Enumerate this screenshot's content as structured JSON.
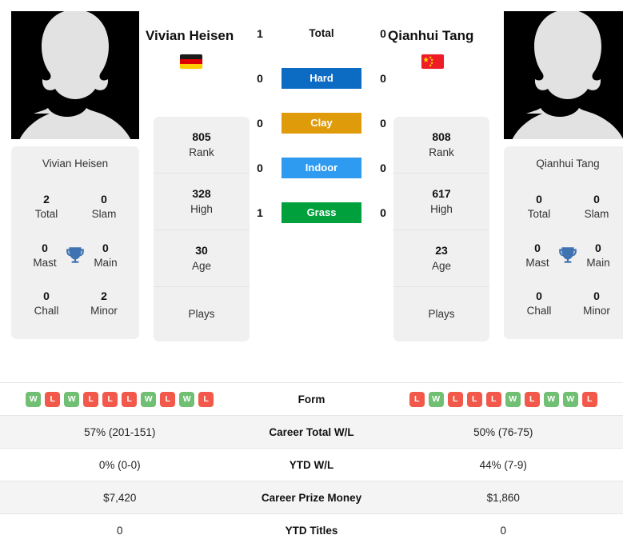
{
  "players": {
    "left": {
      "name": "Vivian Heisen",
      "flag": "germany-flag",
      "avatar": "player-silhouette",
      "rank": "805",
      "rank_label": "Rank",
      "high": "328",
      "high_label": "High",
      "age": "30",
      "age_label": "Age",
      "plays_label": "Plays",
      "plays_value": "",
      "titles": {
        "total": "2",
        "total_label": "Total",
        "slam": "0",
        "slam_label": "Slam",
        "mast": "0",
        "mast_label": "Mast",
        "main": "0",
        "main_label": "Main",
        "chall": "0",
        "chall_label": "Chall",
        "minor": "2",
        "minor_label": "Minor"
      },
      "scores": {
        "total": "1",
        "hard": "0",
        "clay": "0",
        "indoor": "0",
        "grass": "1"
      },
      "form": [
        "W",
        "L",
        "W",
        "L",
        "L",
        "L",
        "W",
        "L",
        "W",
        "L"
      ],
      "career_total_wl": "57% (201-151)",
      "ytd_wl": "0% (0-0)",
      "career_prize_money": "$7,420",
      "ytd_titles": "0"
    },
    "right": {
      "name": "Qianhui Tang",
      "flag": "china-flag",
      "avatar": "player-silhouette",
      "rank": "808",
      "rank_label": "Rank",
      "high": "617",
      "high_label": "High",
      "age": "23",
      "age_label": "Age",
      "plays_label": "Plays",
      "plays_value": "",
      "titles": {
        "total": "0",
        "total_label": "Total",
        "slam": "0",
        "slam_label": "Slam",
        "mast": "0",
        "mast_label": "Mast",
        "main": "0",
        "main_label": "Main",
        "chall": "0",
        "chall_label": "Chall",
        "minor": "0",
        "minor_label": "Minor"
      },
      "scores": {
        "total": "0",
        "hard": "0",
        "clay": "0",
        "indoor": "0",
        "grass": "0"
      },
      "form": [
        "L",
        "W",
        "L",
        "L",
        "L",
        "W",
        "L",
        "W",
        "W",
        "L"
      ],
      "career_total_wl": "50% (76-75)",
      "ytd_wl": "44% (7-9)",
      "career_prize_money": "$1,860",
      "ytd_titles": "0"
    }
  },
  "surfaces": [
    {
      "key": "total",
      "label": "Total",
      "color": "transparent",
      "text_color": "#111111"
    },
    {
      "key": "hard",
      "label": "Hard",
      "color": "#0c6cc4",
      "text_color": "#ffffff"
    },
    {
      "key": "clay",
      "label": "Clay",
      "color": "#e09b0a",
      "text_color": "#ffffff"
    },
    {
      "key": "indoor",
      "label": "Indoor",
      "color": "#2e9bf0",
      "text_color": "#ffffff"
    },
    {
      "key": "grass",
      "label": "Grass",
      "color": "#00a03c",
      "text_color": "#ffffff"
    }
  ],
  "stats_rows": [
    {
      "label": "Form",
      "key": "form",
      "type": "badges"
    },
    {
      "label": "Career Total W/L",
      "key": "career_total_wl",
      "type": "text"
    },
    {
      "label": "YTD W/L",
      "key": "ytd_wl",
      "type": "text"
    },
    {
      "label": "Career Prize Money",
      "key": "career_prize_money",
      "type": "text"
    },
    {
      "label": "YTD Titles",
      "key": "ytd_titles",
      "type": "text"
    }
  ],
  "colors": {
    "win_badge": "#70bf73",
    "loss_badge": "#f2594b",
    "trophy": "#3f72b0",
    "card_bg": "#f0f0f0",
    "row_shade": "#f4f4f4"
  }
}
